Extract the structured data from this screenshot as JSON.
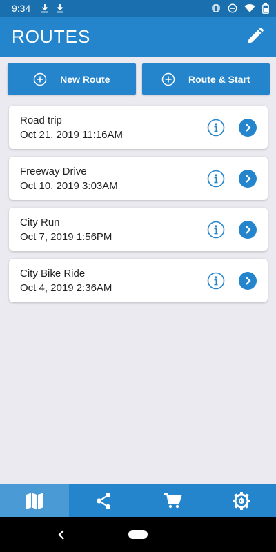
{
  "status_bar": {
    "time": "9:34",
    "icons": [
      "download-icon",
      "download-icon",
      "vibrate-icon",
      "dnd-icon",
      "wifi-icon",
      "battery-icon"
    ]
  },
  "app_bar": {
    "title": "ROUTES",
    "edit_icon": "pencil-icon"
  },
  "actions": {
    "new_route_label": "New Route",
    "route_start_label": "Route & Start"
  },
  "routes": [
    {
      "name": "Road trip",
      "date": "Oct 21, 2019 11:16AM"
    },
    {
      "name": "Freeway Drive",
      "date": "Oct 10, 2019 3:03AM"
    },
    {
      "name": "City Run",
      "date": "Oct 7, 2019 1:56PM"
    },
    {
      "name": "City Bike Ride",
      "date": "Oct 4, 2019 2:36AM"
    }
  ],
  "bottom_nav": [
    "map-icon",
    "share-icon",
    "cart-icon",
    "gear-icon"
  ],
  "colors": {
    "primary": "#2585cc",
    "status": "#1a6fae",
    "nav_active": "#4a9ad6",
    "background": "#ebeaf0"
  }
}
